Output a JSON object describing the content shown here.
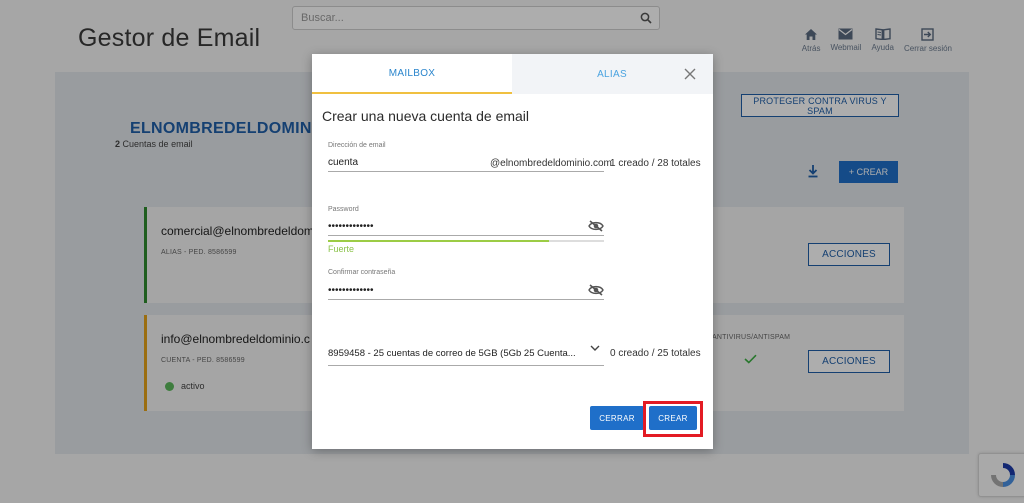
{
  "header": {
    "title": "Gestor de Email",
    "search_placeholder": "Buscar...",
    "nav": [
      {
        "label": "Atrás",
        "icon": "home-icon"
      },
      {
        "label": "Webmail",
        "icon": "mail-icon"
      },
      {
        "label": "Ayuda",
        "icon": "book-icon"
      },
      {
        "label": "Cerrar sesión",
        "icon": "logout-icon"
      }
    ]
  },
  "domain": {
    "name": "ELNOMBREDELDOMINIO",
    "count_number": "2",
    "count_label": "Cuentas de email",
    "protect_label": "PROTEGER CONTRA VIRUS Y SPAM",
    "create_label": "+ CREAR"
  },
  "accounts": [
    {
      "email": "comercial@elnombredeldom",
      "meta": "ALIAS - PED. 8586599",
      "actions": "ACCIONES"
    },
    {
      "email": "info@elnombredeldominio.c",
      "meta": "CUENTA - PED. 8586599",
      "status": "activo",
      "antivirus_label": "ANTIVIRUS/ANTISPAM",
      "actions": "ACCIONES"
    }
  ],
  "modal": {
    "tabs": {
      "mailbox": "MAILBOX",
      "alias": "ALIAS"
    },
    "title": "Crear una nueva cuenta de email",
    "email_label": "Dirección de email",
    "email_value": "cuenta",
    "email_suffix": "@elnombredeldominio.com",
    "email_count": "1 creado / 28 totales",
    "password_label": "Password",
    "password_value": "•••••••••••••",
    "strength_label": "Fuerte",
    "strength_level": 0.8,
    "confirm_label": "Confirmar contraseña",
    "confirm_value": "•••••••••••••",
    "plan_value": "8959458 - 25 cuentas de correo de 5GB (5Gb 25 Cuenta...",
    "plan_count": "0 creado / 25 totales",
    "close_button": "CERRAR",
    "create_button": "CREAR"
  },
  "colors": {
    "primary": "#1f6fc9",
    "strength": "#9ccc45",
    "highlight": "#e31b23",
    "alias_border": "#2e8b2e",
    "account_border": "#e5a21a"
  }
}
